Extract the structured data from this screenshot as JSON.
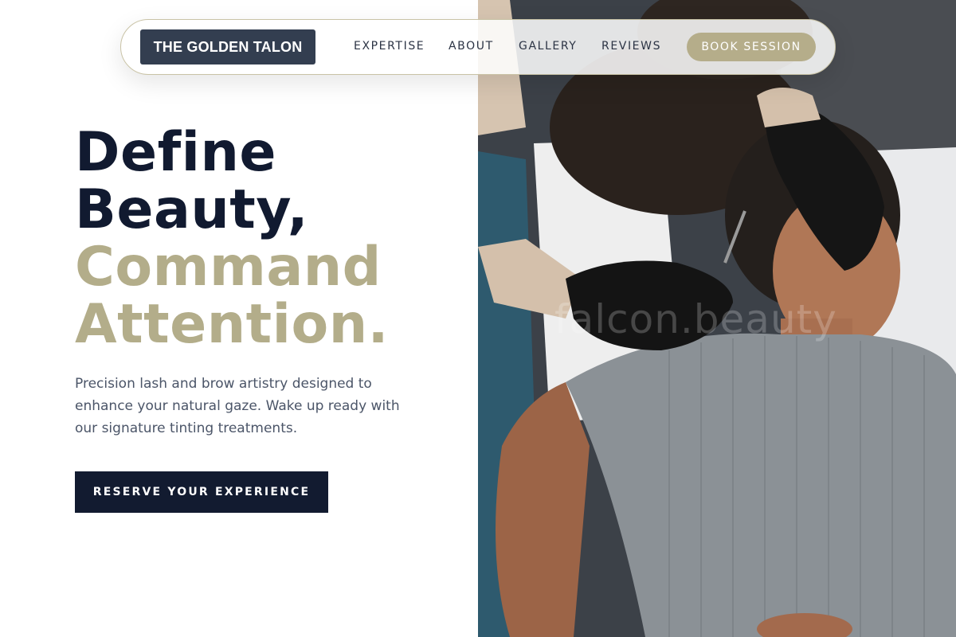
{
  "brand": {
    "name": "THE GOLDEN TALON"
  },
  "nav": {
    "links": [
      {
        "label": "EXPERTISE"
      },
      {
        "label": "ABOUT"
      },
      {
        "label": "GALLERY"
      },
      {
        "label": "REVIEWS"
      }
    ],
    "cta_label": "BOOK SESSION"
  },
  "hero": {
    "headline_lines": [
      {
        "text": "Define",
        "tone": "dark"
      },
      {
        "text": "Beauty,",
        "tone": "dark"
      },
      {
        "text": "Command",
        "tone": "gold"
      },
      {
        "text": "Attention.",
        "tone": "gold"
      }
    ],
    "lead": "Precision lash and brow artistry designed to enhance your natural gaze. Wake up ready with our signature tinting treatments.",
    "cta_label": "RESERVE YOUR EXPERIENCE"
  },
  "photo": {
    "description_icon": "brow-treatment-photo",
    "watermark": "falcon.beauty"
  },
  "colors": {
    "navy": "#111a30",
    "gold": "#b3ad8a",
    "logo_bg": "#333e50",
    "body_text": "#4b5568"
  }
}
